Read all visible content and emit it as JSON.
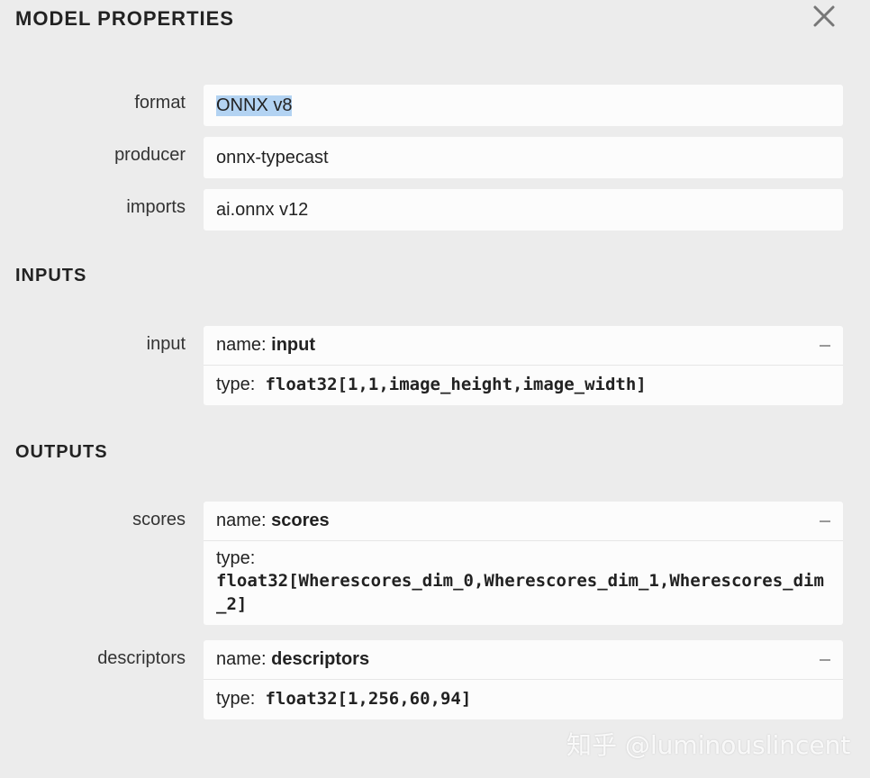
{
  "title": "MODEL PROPERTIES",
  "close_icon": "close-icon",
  "properties": [
    {
      "label": "format",
      "value": "ONNX v8"
    },
    {
      "label": "producer",
      "value": "onnx-typecast"
    },
    {
      "label": "imports",
      "value": "ai.onnx v12"
    }
  ],
  "inputs": {
    "title": "INPUTS",
    "items": [
      {
        "label": "input",
        "name_prefix": "name: ",
        "name": "input",
        "type_prefix": "type: ",
        "type": "float32[1,1,image_height,image_width]"
      }
    ]
  },
  "outputs": {
    "title": "OUTPUTS",
    "items": [
      {
        "label": "scores",
        "name_prefix": "name: ",
        "name": "scores",
        "type_prefix": "type:",
        "type": "float32[Wherescores_dim_0,Wherescores_dim_1,Wherescores_dim_2]"
      },
      {
        "label": "descriptors",
        "name_prefix": "name: ",
        "name": "descriptors",
        "type_prefix": "type: ",
        "type": "float32[1,256,60,94]"
      }
    ]
  },
  "watermark": "知乎 @luminouslincent",
  "colors": {
    "background": "#ececec",
    "box": "#fcfcfc",
    "selection": "#b3d3f2"
  }
}
